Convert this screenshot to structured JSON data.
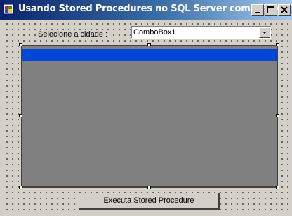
{
  "window": {
    "title": "Usando Stored Procedures no SQL Server com VB .NET",
    "titlebar_gradient": [
      "#0a246a",
      "#a6caf0"
    ]
  },
  "form": {
    "city_label": "Selecione a cidade :",
    "city_combo_value": "ComboBox1",
    "execute_button": "Executa Stored Procedure"
  },
  "colors": {
    "grid_background": "#808080",
    "grid_caption": "#0047d6",
    "form_background": "#d4d0c8"
  },
  "icons": [
    "app-icon",
    "minimize-icon",
    "maximize-icon",
    "close-icon",
    "dropdown-arrow-icon"
  ]
}
